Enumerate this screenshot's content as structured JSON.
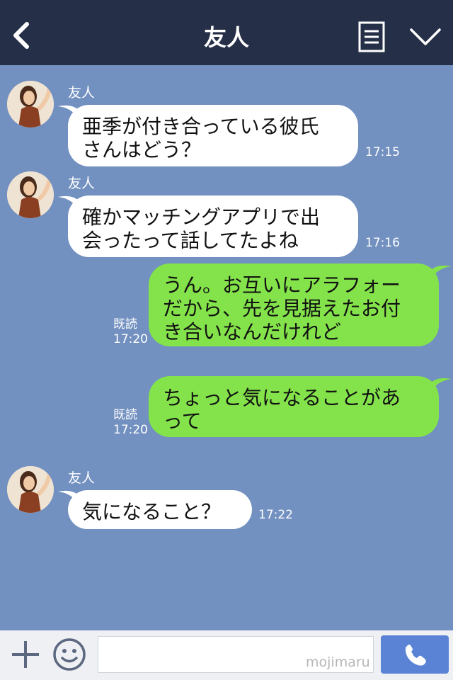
{
  "header": {
    "title": "友人"
  },
  "messages": [
    {
      "side": "in",
      "sender": "友人",
      "lines": [
        "亜季が付き合っている彼氏",
        "さんはどう？"
      ],
      "time": "17:15"
    },
    {
      "side": "in",
      "sender": "友人",
      "lines": [
        "確かマッチングアプリで出",
        "会ったって話してたよね"
      ],
      "time": "17:16"
    },
    {
      "side": "out",
      "read": "既読",
      "lines": [
        "うん。お互いにアラフォー",
        "だから、先を見据えたお付",
        "き合いなんだけれど"
      ],
      "time": "17:20"
    },
    {
      "side": "out",
      "read": "既読",
      "lines": [
        "ちょっと気になることがあ",
        "って"
      ],
      "time": "17:20"
    },
    {
      "side": "in",
      "sender": "友人",
      "lines": [
        "気になること？"
      ],
      "time": "17:22"
    }
  ],
  "input": {
    "placeholder": "",
    "watermark": "mojimaru"
  },
  "colors": {
    "header": "#262f48",
    "background": "#7290c0",
    "bubble_out": "#84e34b",
    "bubble_in": "#ffffff",
    "call_button": "#5a83d6"
  },
  "icons": {
    "back": "chevron-left-icon",
    "menu": "menu-icon",
    "collapse": "chevron-down-icon",
    "plus": "plus-icon",
    "emoji": "smile-icon",
    "call": "phone-icon"
  }
}
